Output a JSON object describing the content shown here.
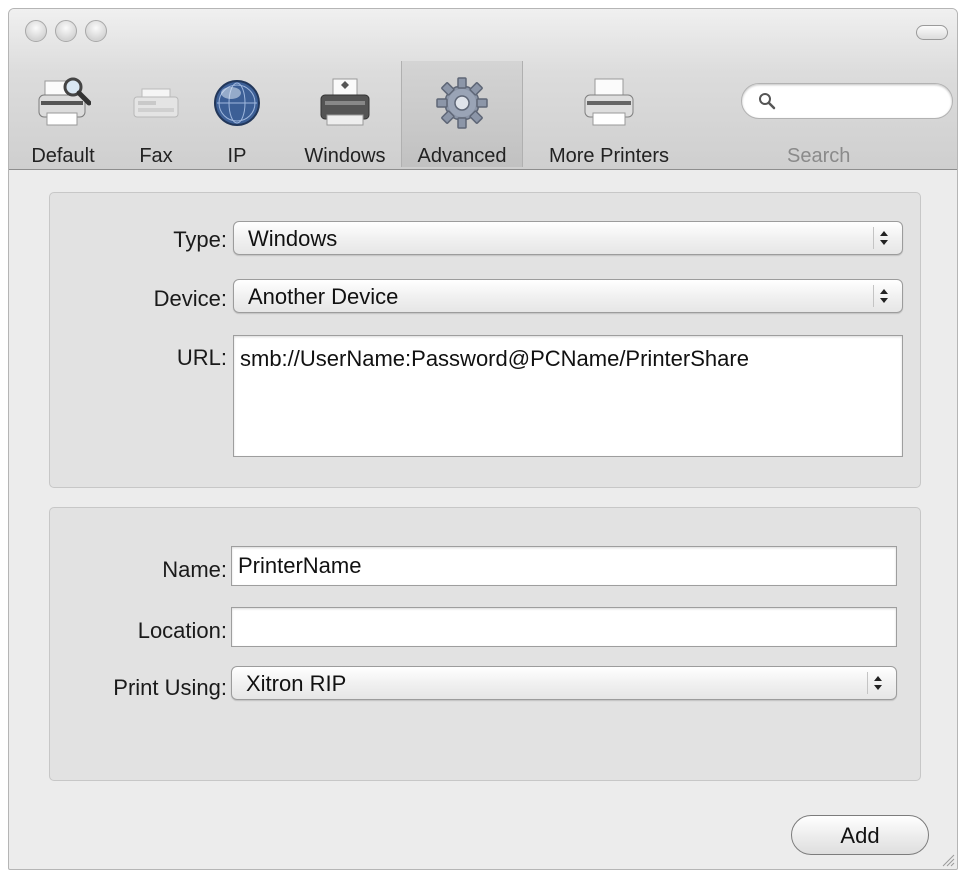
{
  "window": {
    "toolbar": {
      "items": [
        {
          "label": "Default",
          "icon": "default-printer-icon"
        },
        {
          "label": "Fax",
          "icon": "fax-icon"
        },
        {
          "label": "IP",
          "icon": "globe-icon"
        },
        {
          "label": "Windows",
          "icon": "windows-printer-icon"
        },
        {
          "label": "Advanced",
          "icon": "gear-icon",
          "selected": true
        },
        {
          "label": "More Printers",
          "icon": "printer-icon"
        }
      ],
      "search": {
        "label": "Search",
        "value": "",
        "icon": "search-icon"
      }
    }
  },
  "device_group": {
    "type": {
      "label": "Type:",
      "value": "Windows"
    },
    "device": {
      "label": "Device:",
      "value": "Another Device"
    },
    "url": {
      "label": "URL:",
      "value": "smb://UserName:Password@PCName/PrinterShare"
    }
  },
  "printer_group": {
    "name": {
      "label": "Name:",
      "value": "PrinterName"
    },
    "location": {
      "label": "Location:",
      "value": ""
    },
    "print_using": {
      "label": "Print Using:",
      "value": "Xitron RIP"
    }
  },
  "actions": {
    "add_label": "Add"
  },
  "colors": {
    "window_bg": "#ececec",
    "group_bg": "#e2e2e2",
    "toolbar_bg": "#d6d6d6"
  }
}
